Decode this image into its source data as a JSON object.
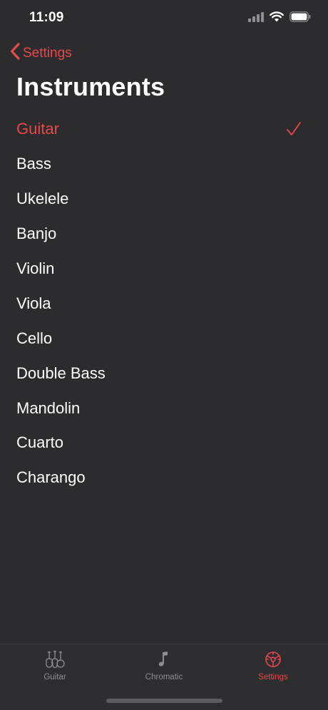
{
  "status_bar": {
    "time": "11:09"
  },
  "nav": {
    "back_label": "Settings",
    "title": "Instruments"
  },
  "instruments": [
    {
      "label": "Guitar",
      "selected": true
    },
    {
      "label": "Bass",
      "selected": false
    },
    {
      "label": "Ukelele",
      "selected": false
    },
    {
      "label": "Banjo",
      "selected": false
    },
    {
      "label": "Violin",
      "selected": false
    },
    {
      "label": "Viola",
      "selected": false
    },
    {
      "label": "Cello",
      "selected": false
    },
    {
      "label": "Double Bass",
      "selected": false
    },
    {
      "label": "Mandolin",
      "selected": false
    },
    {
      "label": "Cuarto",
      "selected": false
    },
    {
      "label": "Charango",
      "selected": false
    }
  ],
  "tab_bar": {
    "tabs": [
      {
        "label": "Guitar",
        "icon": "guitar-icon",
        "active": false
      },
      {
        "label": "Chromatic",
        "icon": "music-note-icon",
        "active": false
      },
      {
        "label": "Settings",
        "icon": "gear-icon",
        "active": true
      }
    ]
  },
  "colors": {
    "accent": "#e5484d",
    "background": "#2c2c2e",
    "inactive": "#8e8e93"
  }
}
